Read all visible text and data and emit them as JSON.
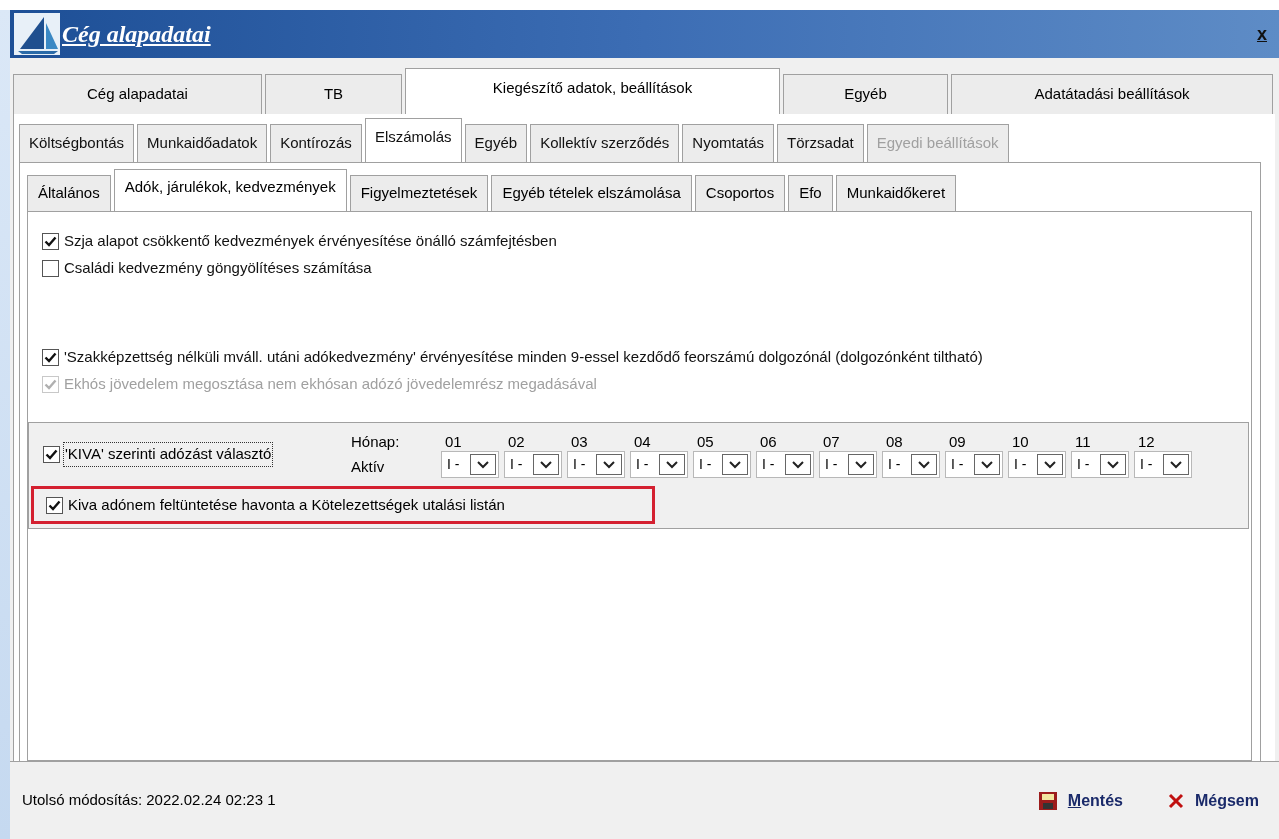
{
  "window": {
    "title": "Cég alapadatai",
    "close": "x"
  },
  "main_tabs": [
    {
      "label": "Cég alapadatai",
      "selected": false
    },
    {
      "label": "TB",
      "selected": false
    },
    {
      "label": "Kiegészítő adatok, beállítások",
      "selected": true
    },
    {
      "label": "Egyéb",
      "selected": false
    },
    {
      "label": "Adatátadási beállítások",
      "selected": false
    }
  ],
  "sub_tabs": [
    {
      "label": "Költségbontás",
      "selected": false,
      "disabled": false
    },
    {
      "label": "Munkaidőadatok",
      "selected": false,
      "disabled": false
    },
    {
      "label": "Kontírozás",
      "selected": false,
      "disabled": false
    },
    {
      "label": "Elszámolás",
      "selected": true,
      "disabled": false
    },
    {
      "label": "Egyéb",
      "selected": false,
      "disabled": false
    },
    {
      "label": "Kollektív szerződés",
      "selected": false,
      "disabled": false
    },
    {
      "label": "Nyomtatás",
      "selected": false,
      "disabled": false
    },
    {
      "label": "Törzsadat",
      "selected": false,
      "disabled": false
    },
    {
      "label": "Egyedi beállítások",
      "selected": false,
      "disabled": true
    }
  ],
  "section_tabs": [
    {
      "label": "Általános",
      "selected": false
    },
    {
      "label": "Adók, járulékok, kedvezmények",
      "selected": true
    },
    {
      "label": "Figyelmeztetések",
      "selected": false
    },
    {
      "label": "Egyéb tételek elszámolása",
      "selected": false
    },
    {
      "label": "Csoportos",
      "selected": false
    },
    {
      "label": "Efo",
      "selected": false
    },
    {
      "label": "Munkaidőkeret",
      "selected": false
    }
  ],
  "szja_options": [
    {
      "label": "Szja alapot csökkentő kedvezmények érvényesítése önálló számfejtésben",
      "checked": true,
      "disabled": false
    },
    {
      "label": "Családi kedvezmény göngyölítéses számítása",
      "checked": false,
      "disabled": false
    }
  ],
  "discount_options": [
    {
      "label": "'Szakképzettség nélküli mváll. utáni adókedvezmény' érvényesítése minden 9-essel kezdődő feorszámú dolgozónál (dolgozónként tiltható)",
      "checked": true,
      "disabled": false
    },
    {
      "label": "Ekhós jövedelem megosztása nem ekhósan adózó jövedelemrész megadásával",
      "checked": true,
      "disabled": true
    }
  ],
  "kiva": {
    "option": {
      "label": "'KIVA' szerinti adózást választó",
      "checked": true,
      "focused": true
    },
    "month_label": "Hónap:",
    "active_label": "Aktív",
    "months": [
      {
        "number": "01",
        "value": "I -"
      },
      {
        "number": "02",
        "value": "I -"
      },
      {
        "number": "03",
        "value": "I -"
      },
      {
        "number": "04",
        "value": "I -"
      },
      {
        "number": "05",
        "value": "I -"
      },
      {
        "number": "06",
        "value": "I -"
      },
      {
        "number": "07",
        "value": "I -"
      },
      {
        "number": "08",
        "value": "I -"
      },
      {
        "number": "09",
        "value": "I -"
      },
      {
        "number": "10",
        "value": "I -"
      },
      {
        "number": "11",
        "value": "I -"
      },
      {
        "number": "12",
        "value": "I -"
      }
    ],
    "listing_option": {
      "label": "Kiva adónem feltüntetése havonta a Kötelezettségek utalási listán",
      "checked": true,
      "highlighted": true
    }
  },
  "footer": {
    "last_modified": "Utolsó módosítás: 2022.02.24 02:23 1",
    "buttons": [
      {
        "kind": "save",
        "hotkey": "M",
        "after": "entés"
      },
      {
        "kind": "cancel",
        "before": "Mé",
        "hotkey": "g",
        "after": "sem"
      }
    ]
  }
}
